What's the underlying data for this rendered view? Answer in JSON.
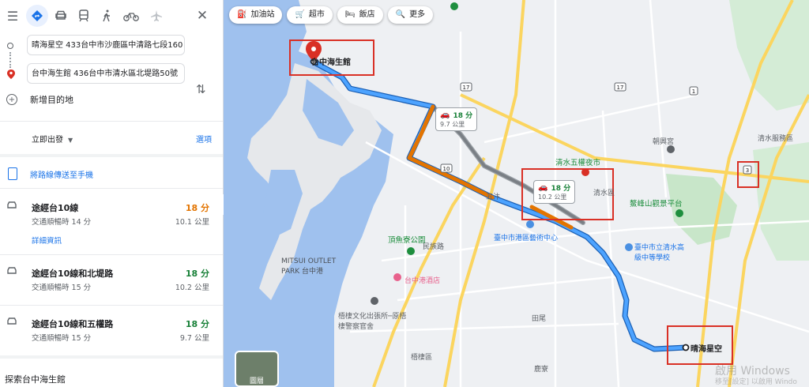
{
  "modes": {
    "active": "driving"
  },
  "inputs": {
    "origin": "晴海星空 433台中市沙鹿區中清路七段160",
    "destination": "台中海生館 436台中市清水區北堤路50號"
  },
  "add_destination": "新增目的地",
  "depart": "立即出發",
  "options": "選項",
  "send_to_phone": "將路線傳送至手機",
  "routes": [
    {
      "name": "途經台10線",
      "time": "18 分",
      "time_color": "#e37400",
      "sub": "交通順暢時 14 分",
      "dist": "10.1 公里",
      "detail": "詳細資訊"
    },
    {
      "name": "途經台10線和北堤路",
      "time": "18 分",
      "time_color": "#188038",
      "sub": "交通順暢時 15 分",
      "dist": "10.2 公里"
    },
    {
      "name": "途經台10線和五權路",
      "time": "18 分",
      "time_color": "#188038",
      "sub": "交通順暢時 15 分",
      "dist": "9.7 公里"
    }
  ],
  "explore": "探索台中海生館",
  "chips": [
    "加油站",
    "超市",
    "飯店",
    "更多"
  ],
  "map": {
    "destination_label": "台中海生館",
    "origin_label": "晴海星空",
    "callouts": [
      {
        "time": "18 分",
        "dist": "9.7 公里"
      },
      {
        "time": "18 分",
        "dist": "10.2 公里"
      }
    ],
    "places": {
      "a": "清水五權夜市",
      "b": "朝興宮",
      "c": "清水服務區",
      "d": "鰲峰山觀景平台",
      "e": "頂魚寮公園",
      "f": "臺中市港區藝術中心",
      "g": "臺中市立清水高級中等學校",
      "h": "台中港酒店",
      "i": "MITSUI OUTLET PARK 台中港",
      "j": "梧棲文化出張所─原梧棲警察官舍",
      "k": "清水區",
      "l": "梧棲區",
      "m": "田尾",
      "n": "鹿寮",
      "o": "五汴",
      "p": "民族路"
    },
    "road_badges": [
      "10",
      "17",
      "1",
      "3"
    ]
  },
  "layer_label": "圖層",
  "watermark": "啟用 Windows",
  "watermark2": "移至[設定] 以啟用 Windo"
}
